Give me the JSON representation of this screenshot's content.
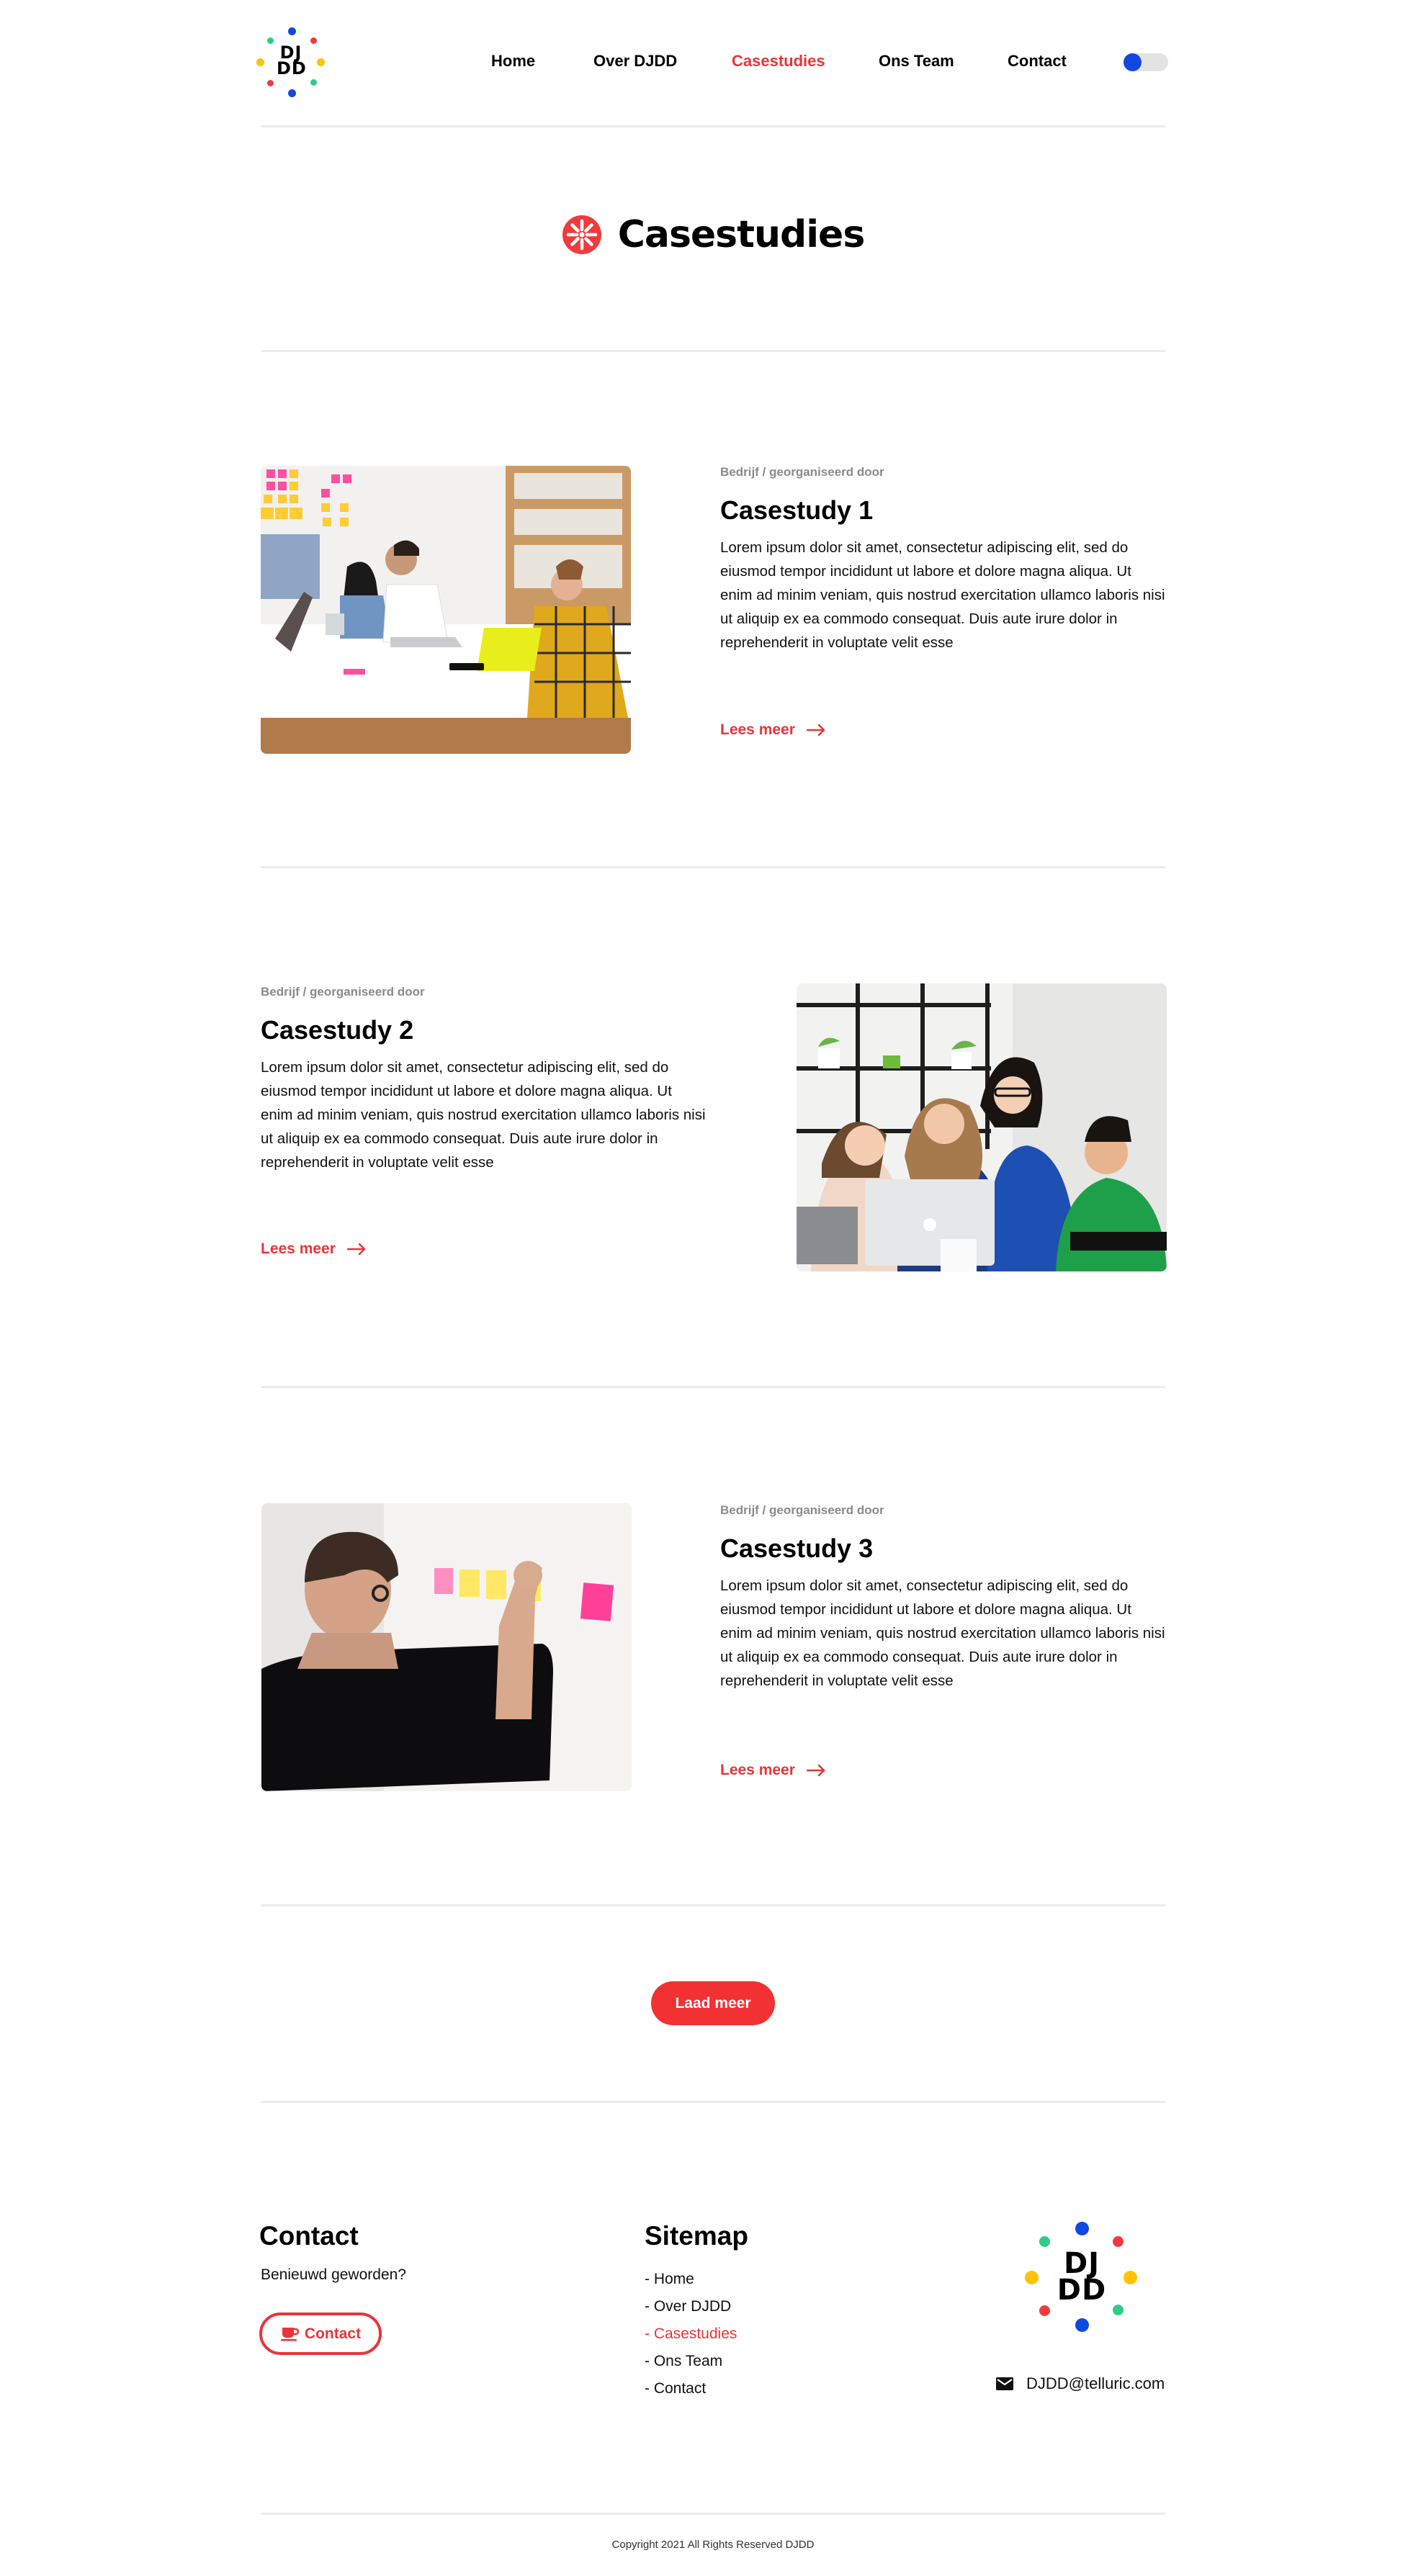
{
  "brand": {
    "logo_line1": "DJ",
    "logo_line2": "DD",
    "colors": {
      "blue": "#1248e0",
      "red": "#ef3b3f",
      "green": "#2ecc85",
      "yellow": "#ffc400",
      "accent": "#e8353a"
    }
  },
  "nav": {
    "items": [
      {
        "label": "Home",
        "active": false
      },
      {
        "label": "Over DJDD",
        "active": false
      },
      {
        "label": "Casestudies",
        "active": true
      },
      {
        "label": "Ons Team",
        "active": false
      },
      {
        "label": "Contact",
        "active": false
      }
    ],
    "theme_toggle": {
      "icon": "toggle-switch",
      "state": "off"
    }
  },
  "page": {
    "title": "Casestudies",
    "title_icon": "asterisk-circle-icon"
  },
  "cases": [
    {
      "meta": "Bedrijf / georganiseerd door",
      "title": "Casestudy 1",
      "body": "Lorem ipsum dolor sit amet, consectetur adipiscing elit, sed do eiusmod tempor incididunt ut labore et dolore magna aliqua. Ut enim ad minim veniam, quis nostrud exercitation ullamco laboris nisi ut aliquip ex ea commodo consequat. Duis aute irure dolor in reprehenderit in voluptate velit esse",
      "link": "Lees meer",
      "image_alt": "Team meeting around a white table with laptops and sticky notes"
    },
    {
      "meta": "Bedrijf / georganiseerd door",
      "title": "Casestudy 2",
      "body": "Lorem ipsum dolor sit amet, consectetur adipiscing elit, sed do eiusmod tempor incididunt ut labore et dolore magna aliqua. Ut enim ad minim veniam, quis nostrud exercitation ullamco laboris nisi ut aliquip ex ea commodo consequat. Duis aute irure dolor in reprehenderit in voluptate velit esse",
      "link": "Lees meer",
      "image_alt": "Four people looking at a laptop together"
    },
    {
      "meta": "Bedrijf / georganiseerd door",
      "title": "Casestudy 3",
      "body": "Lorem ipsum dolor sit amet, consectetur adipiscing elit, sed do eiusmod tempor incididunt ut labore et dolore magna aliqua. Ut enim ad minim veniam, quis nostrud exercitation ullamco laboris nisi ut aliquip ex ea commodo consequat. Duis aute irure dolor in reprehenderit in voluptate velit esse",
      "link": "Lees meer",
      "image_alt": "Man placing sticky notes on a white wall"
    }
  ],
  "load_more": "Laad meer",
  "footer": {
    "contact": {
      "heading": "Contact",
      "text": "Benieuwd geworden?",
      "button": "Contact",
      "button_icon": "coffee-cup-icon"
    },
    "sitemap": {
      "heading": "Sitemap",
      "items": [
        {
          "label": "- Home",
          "active": false
        },
        {
          "label": "- Over DJDD",
          "active": false
        },
        {
          "label": "- Casestudies",
          "active": true
        },
        {
          "label": "- Ons Team",
          "active": false
        },
        {
          "label": "- Contact",
          "active": false
        }
      ]
    },
    "email": "DJDD@telluric.com",
    "email_icon": "envelope-icon",
    "copyright": "Copyright 2021 All Rights Reserved DJDD"
  }
}
